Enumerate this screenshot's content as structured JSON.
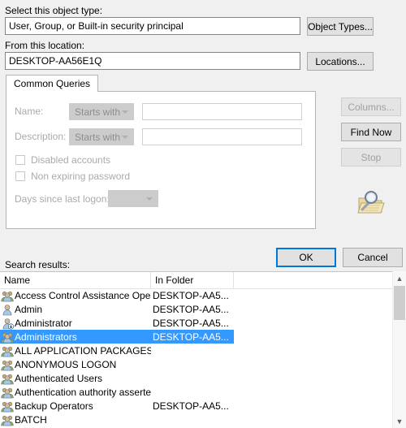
{
  "object_type": {
    "label": "Select this object type:",
    "value": "User, Group, or Built-in security principal",
    "button": "Object Types..."
  },
  "location": {
    "label": "From this location:",
    "value": "DESKTOP-AA56E1Q",
    "button": "Locations..."
  },
  "tabs": [
    {
      "label": "Common Queries",
      "active": true
    }
  ],
  "common_queries": {
    "name": {
      "label": "Name:",
      "operator": "Starts with",
      "value": "",
      "enabled": false
    },
    "description": {
      "label": "Description:",
      "operator": "Starts with",
      "value": "",
      "enabled": false
    },
    "disabled_accounts": {
      "label": "Disabled accounts",
      "checked": false,
      "enabled": false
    },
    "non_expiring_password": {
      "label": "Non expiring password",
      "checked": false,
      "enabled": false
    },
    "days_since_last_logon": {
      "label": "Days since last logon:",
      "value": "",
      "enabled": false
    }
  },
  "side_buttons": {
    "columns": {
      "label": "Columns...",
      "enabled": false
    },
    "find_now": {
      "label": "Find Now",
      "enabled": true
    },
    "stop": {
      "label": "Stop",
      "enabled": false
    },
    "search_icon": "magnifier-folder-icon"
  },
  "dialog_buttons": {
    "ok": {
      "label": "OK",
      "default": true
    },
    "cancel": {
      "label": "Cancel",
      "default": false
    }
  },
  "results": {
    "label": "Search results:",
    "columns": [
      "Name",
      "In Folder"
    ],
    "rows": [
      {
        "icon": "group-icon",
        "name": "Access Control Assistance Opera...",
        "folder": "DESKTOP-AA5...",
        "selected": false
      },
      {
        "icon": "user-icon",
        "name": "Admin",
        "folder": "DESKTOP-AA5...",
        "selected": false
      },
      {
        "icon": "user-admin-icon",
        "name": "Administrator",
        "folder": "DESKTOP-AA5...",
        "selected": false
      },
      {
        "icon": "group-icon",
        "name": "Administrators",
        "folder": "DESKTOP-AA5...",
        "selected": true
      },
      {
        "icon": "group-icon",
        "name": "ALL APPLICATION PACKAGES",
        "folder": "",
        "selected": false
      },
      {
        "icon": "group-icon",
        "name": "ANONYMOUS LOGON",
        "folder": "",
        "selected": false
      },
      {
        "icon": "group-icon",
        "name": "Authenticated Users",
        "folder": "",
        "selected": false
      },
      {
        "icon": "group-icon",
        "name": "Authentication authority asserted i...",
        "folder": "",
        "selected": false
      },
      {
        "icon": "group-icon",
        "name": "Backup Operators",
        "folder": "DESKTOP-AA5...",
        "selected": false
      },
      {
        "icon": "group-icon",
        "name": "BATCH",
        "folder": "",
        "selected": false
      }
    ],
    "scrollbar": {
      "up_arrow": "chevron-up-icon",
      "down_arrow": "chevron-down-icon"
    }
  },
  "colors": {
    "selection": "#3399ff",
    "default_button_border": "#0078d7",
    "dialog_background": "#f0f0f0"
  }
}
